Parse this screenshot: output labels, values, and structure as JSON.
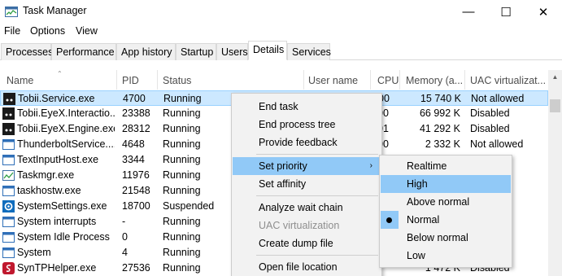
{
  "window": {
    "title": "Task Manager",
    "min_glyph": "—",
    "max_glyph": "☐",
    "close_glyph": "✕"
  },
  "menubar": [
    "File",
    "Options",
    "View"
  ],
  "tabs": [
    "Processes",
    "Performance",
    "App history",
    "Startup",
    "Users",
    "Details",
    "Services"
  ],
  "active_tab": "Details",
  "columns": [
    "Name",
    "PID",
    "Status",
    "User name",
    "CPU",
    "Memory (a...",
    "UAC virtualizat..."
  ],
  "rows": [
    {
      "name": "Tobii.Service.exe",
      "pid": "4700",
      "status": "Running",
      "user": "",
      "cpu": "00",
      "memory": "15 740 K",
      "uac": "Not allowed",
      "icon": "tobii-icon",
      "selected": true
    },
    {
      "name": "Tobii.EyeX.Interactio...",
      "pid": "23388",
      "status": "Running",
      "user": "",
      "cpu": "00",
      "memory": "66 992 K",
      "uac": "Disabled",
      "icon": "tobii-icon"
    },
    {
      "name": "Tobii.EyeX.Engine.exe",
      "pid": "28312",
      "status": "Running",
      "user": "",
      "cpu": "01",
      "memory": "41 292 K",
      "uac": "Disabled",
      "icon": "tobii-icon"
    },
    {
      "name": "ThunderboltService....",
      "pid": "4648",
      "status": "Running",
      "user": "",
      "cpu": "00",
      "memory": "2 332 K",
      "uac": "Not allowed",
      "icon": "window-icon"
    },
    {
      "name": "TextInputHost.exe",
      "pid": "3344",
      "status": "Running",
      "user": "",
      "cpu": "",
      "memory": "",
      "uac": "",
      "icon": "window-icon"
    },
    {
      "name": "Taskmgr.exe",
      "pid": "11976",
      "status": "Running",
      "user": "",
      "cpu": "",
      "memory": "",
      "uac": "",
      "icon": "taskmgr-icon"
    },
    {
      "name": "taskhostw.exe",
      "pid": "21548",
      "status": "Running",
      "user": "",
      "cpu": "",
      "memory": "",
      "uac": "",
      "icon": "window-icon"
    },
    {
      "name": "SystemSettings.exe",
      "pid": "18700",
      "status": "Suspended",
      "user": "",
      "cpu": "",
      "memory": "",
      "uac": "",
      "icon": "gear-icon"
    },
    {
      "name": "System interrupts",
      "pid": "-",
      "status": "Running",
      "user": "",
      "cpu": "",
      "memory": "",
      "uac": "",
      "icon": "window-icon"
    },
    {
      "name": "System Idle Process",
      "pid": "0",
      "status": "Running",
      "user": "",
      "cpu": "",
      "memory": "",
      "uac": "",
      "icon": "window-icon"
    },
    {
      "name": "System",
      "pid": "4",
      "status": "Running",
      "user": "",
      "cpu": "",
      "memory": "",
      "uac": "",
      "icon": "window-icon"
    },
    {
      "name": "SynTPHelper.exe",
      "pid": "27536",
      "status": "Running",
      "user": "",
      "cpu": "",
      "memory": "1 472 K",
      "uac": "Disabled",
      "icon": "synaptics-icon"
    }
  ],
  "context_menu": [
    {
      "label": "End task",
      "state": "normal"
    },
    {
      "label": "End process tree",
      "state": "normal"
    },
    {
      "label": "Provide feedback",
      "state": "normal"
    },
    {
      "label": "Set priority",
      "state": "highlighted",
      "submenu": true
    },
    {
      "label": "Set affinity",
      "state": "normal"
    },
    {
      "label": "Analyze wait chain",
      "state": "normal"
    },
    {
      "label": "UAC virtualization",
      "state": "disabled"
    },
    {
      "label": "Create dump file",
      "state": "normal"
    },
    {
      "label": "Open file location",
      "state": "normal"
    }
  ],
  "priority_submenu": [
    {
      "label": "Realtime",
      "state": "normal"
    },
    {
      "label": "High",
      "state": "highlighted"
    },
    {
      "label": "Above normal",
      "state": "normal"
    },
    {
      "label": "Normal",
      "state": "checked"
    },
    {
      "label": "Below normal",
      "state": "normal"
    },
    {
      "label": "Low",
      "state": "normal"
    }
  ],
  "colors": {
    "selection": "#cce8ff",
    "menu_highlight": "#91c9f7",
    "menu_bg": "#f2f2f2"
  }
}
